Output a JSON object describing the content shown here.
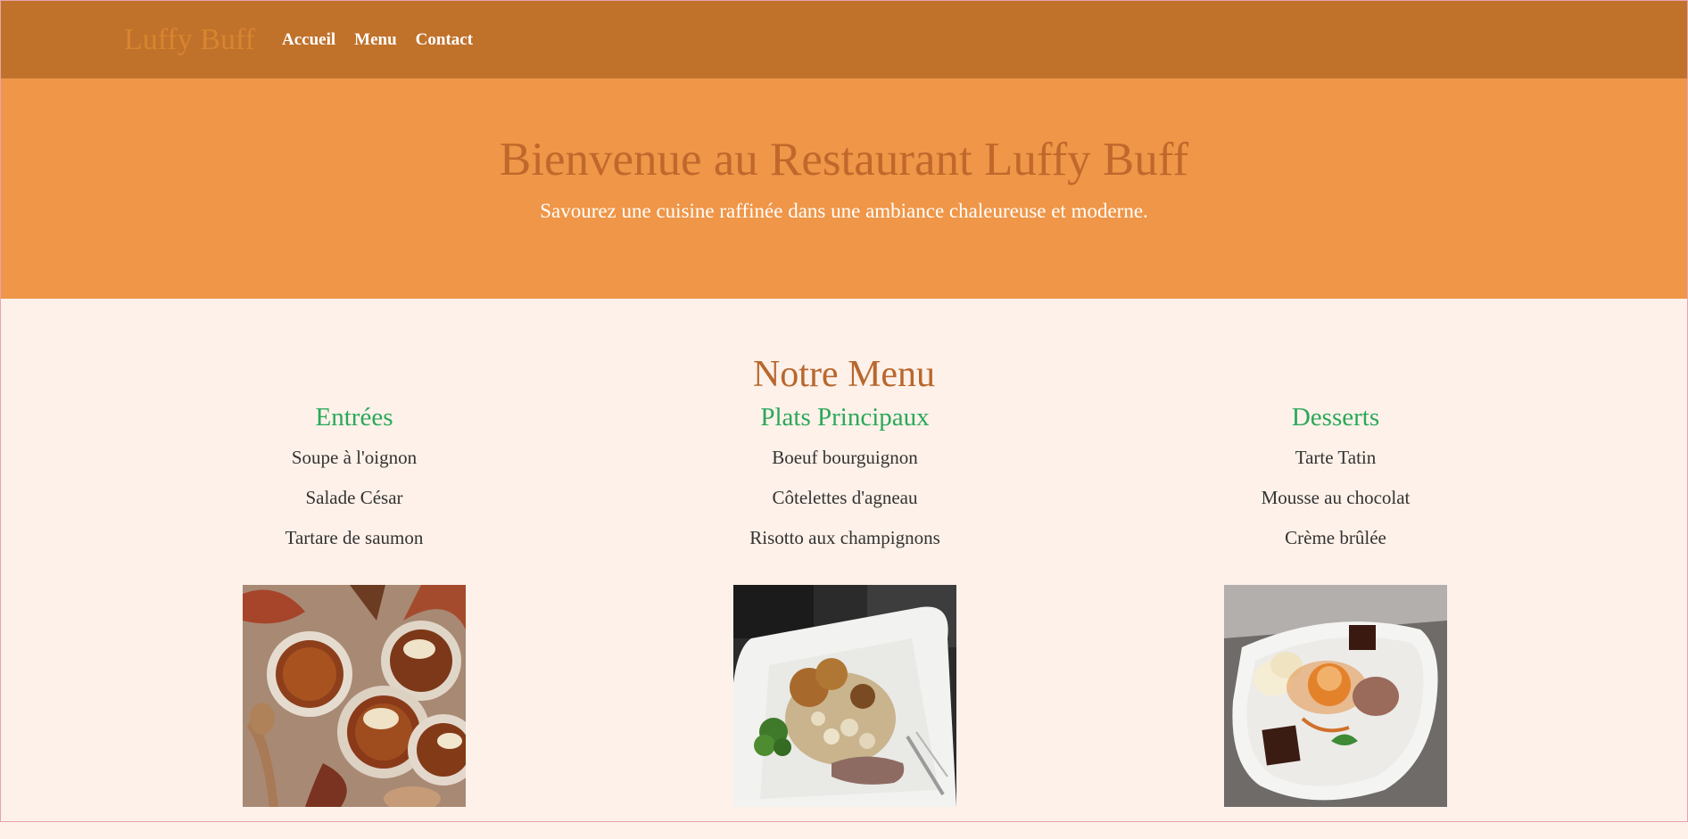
{
  "nav": {
    "brand": "Luffy Buff",
    "links": [
      "Accueil",
      "Menu",
      "Contact"
    ]
  },
  "hero": {
    "title": "Bienvenue au Restaurant Luffy Buff",
    "subtitle": "Savourez une cuisine raffinée dans une ambiance chaleureuse et moderne."
  },
  "menu": {
    "title": "Notre Menu",
    "categories": [
      {
        "name": "Entrées",
        "items": [
          "Soupe à l'oignon",
          "Salade César",
          "Tartare de saumon"
        ]
      },
      {
        "name": "Plats Principaux",
        "items": [
          "Boeuf bourguignon",
          "Côtelettes d'agneau",
          "Risotto aux champignons"
        ]
      },
      {
        "name": "Desserts",
        "items": [
          "Tarte Tatin",
          "Mousse au chocolat",
          "Crème brûlée"
        ]
      }
    ]
  },
  "colors": {
    "navbar": "#c0722b",
    "hero": "#ef9648",
    "accent_title": "#b8672d",
    "category": "#2aa85a",
    "page_bg": "#fdf1e9"
  }
}
